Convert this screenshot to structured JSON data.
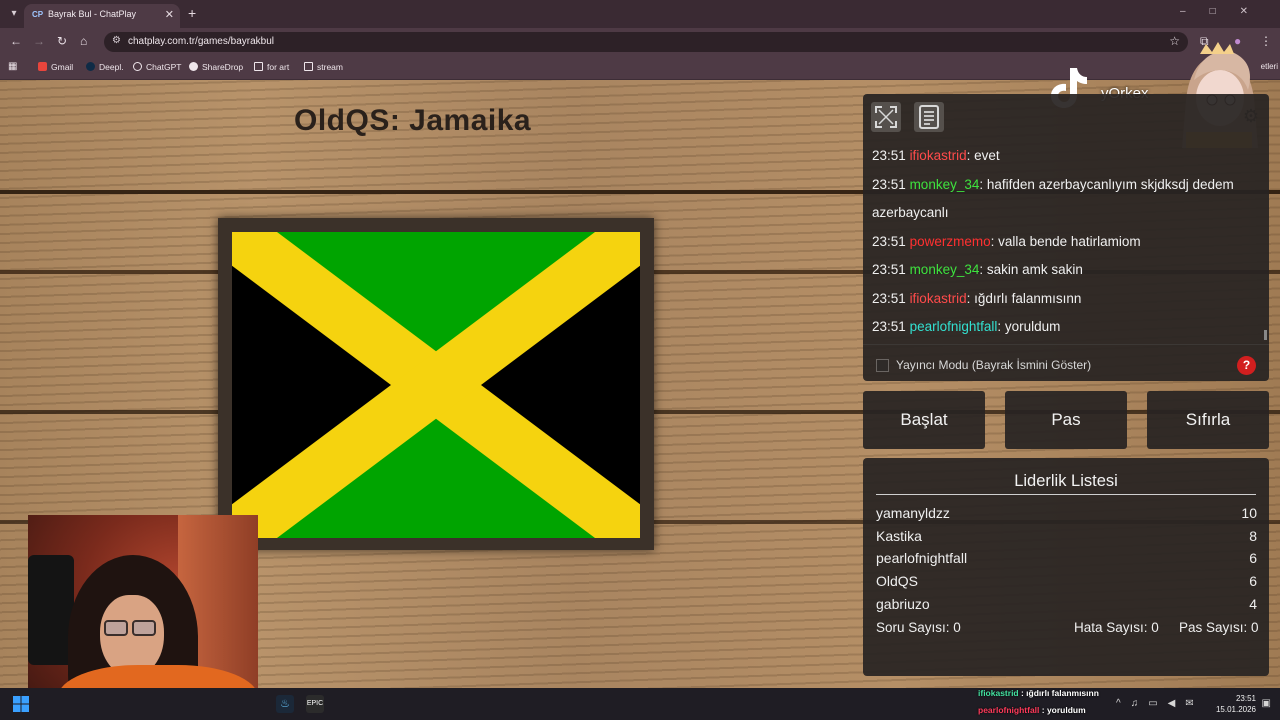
{
  "browser": {
    "tab_title": "Bayrak Bul - ChatPlay",
    "favicon_text": "CP",
    "url": "chatplay.com.tr/games/bayrakbul",
    "bookmarks": [
      {
        "label": "Gmail"
      },
      {
        "label": "Deepl."
      },
      {
        "label": "ChatGPT"
      },
      {
        "label": "ShareDrop"
      },
      {
        "label": "for art"
      },
      {
        "label": "stream"
      }
    ],
    "bookmarks_overflow": "etleri"
  },
  "game": {
    "title": "OldQS: Jamaika",
    "flag_colors": {
      "green": "#00a400",
      "gold": "#f5d30f",
      "black": "#000000"
    }
  },
  "overlay": {
    "tiktok_name": "yOrkex"
  },
  "chat": {
    "messages": [
      {
        "time": "23:51",
        "user": "ifiokastrid",
        "color": "#ff4b4b",
        "text": ": evet"
      },
      {
        "time": "23:51",
        "user": "monkey_34",
        "color": "#3ee23e",
        "text": ": hafifden azerbaycanlıyım skjdksdj dedem azerbaycanlı"
      },
      {
        "time": "23:51",
        "user": "powerzmemo",
        "color": "#ff3030",
        "text": ": valla bende hatirlamiom"
      },
      {
        "time": "23:51",
        "user": "monkey_34",
        "color": "#3ee23e",
        "text": ": sakin amk sakin"
      },
      {
        "time": "23:51",
        "user": "ifiokastrid",
        "color": "#ff4b4b",
        "text": ": ığdırlı falanmısınn"
      },
      {
        "time": "23:51",
        "user": "pearlofnightfall",
        "color": "#33e0d0",
        "text": ": yoruldum"
      }
    ],
    "streamer_mode_label": "Yayıncı Modu (Bayrak İsmini Göster)",
    "help_label": "?"
  },
  "actions": {
    "start": "Başlat",
    "pass": "Pas",
    "reset": "Sıfırla"
  },
  "leaderboard": {
    "title": "Liderlik Listesi",
    "rows": [
      {
        "name": "yamanyldzz",
        "score": "10"
      },
      {
        "name": "Kastika",
        "score": "8"
      },
      {
        "name": "pearlofnightfall",
        "score": "6"
      },
      {
        "name": "OldQS",
        "score": "6"
      },
      {
        "name": "gabriuzo",
        "score": "4"
      }
    ],
    "question_count": "Soru Sayısı: 0",
    "error_count": "Hata Sayısı: 0",
    "pass_count": "Pas Sayısı: 0"
  },
  "taskbar": {
    "chat_lines": [
      {
        "user": "ifiokastrid",
        "color": "#43e0a0",
        "text": " : ığdırlı falanmısınn"
      },
      {
        "user": "pearlofnightfall",
        "color": "#ff3a5a",
        "text": " : yoruldum"
      }
    ],
    "time": "23:51",
    "date": "15.01.2026",
    "app_label": "EPIC"
  }
}
